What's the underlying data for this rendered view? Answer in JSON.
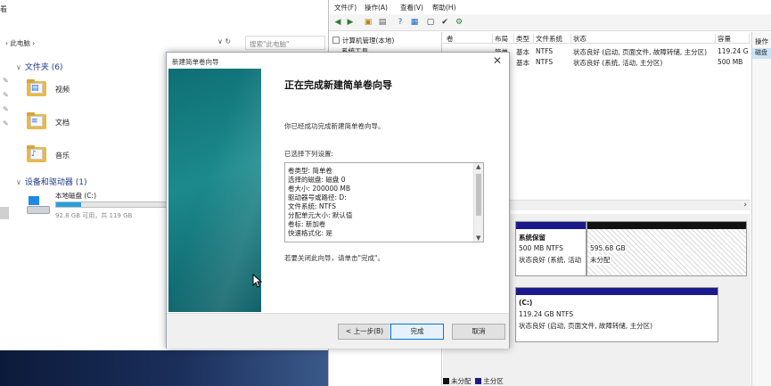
{
  "explorer": {
    "title_fragment": "看",
    "breadcrumb": "› 此电脑 ›",
    "address_controls": "∨ ↻",
    "search_placeholder": "搜索\"此电脑\"",
    "folders_header": "文件夹 (6)",
    "folders": [
      {
        "label": "视频",
        "icon": "video-folder-icon"
      },
      {
        "label": "文档",
        "icon": "document-folder-icon"
      },
      {
        "label": "音乐",
        "icon": "music-folder-icon"
      }
    ],
    "devices_header": "设备和驱动器 (1)",
    "drive": {
      "label": "本地磁盘 (C:)",
      "free_text": "92.8 GB 可用，共 119 GB",
      "used_fraction": 0.22
    }
  },
  "mmc": {
    "menu": [
      "文件(F)",
      "操作(A)",
      "查看(V)",
      "帮助(H)"
    ],
    "tree": [
      "计算机管理(本地)",
      "系统工具"
    ],
    "columns": [
      "卷",
      "布局",
      "类型",
      "文件系统",
      "状态",
      "容量"
    ],
    "rows": [
      {
        "vol": "",
        "layout": "简单",
        "type": "基本",
        "fs": "NTFS",
        "status": "状态良好 (启动, 页面文件, 故障转储, 主分区)",
        "size": "119.24 G"
      },
      {
        "vol": "",
        "layout": "简单",
        "type": "基本",
        "fs": "NTFS",
        "status": "状态良好 (系统, 活动, 主分区)",
        "size": "500 MB"
      }
    ],
    "actions_title": "操作",
    "actions_selected": "磁盘",
    "disk0": [
      {
        "name": "系统保留",
        "line1": "500 MB NTFS",
        "line2": "状态良好 (系统, 活动"
      },
      {
        "name": "",
        "line1": "595.68 GB",
        "line2": "未分配"
      }
    ],
    "disk1": {
      "name": "(C:)",
      "line1": "119.24 GB NTFS",
      "line2": "状态良好 (启动, 页面文件, 故障转储, 主分区)"
    },
    "legend": [
      {
        "label": "未分配",
        "color": "#111111"
      },
      {
        "label": "主分区",
        "color": "#1a1a8c"
      }
    ]
  },
  "wizard": {
    "window_title": "新建简单卷向导",
    "close_label": "✕",
    "heading": "正在完成新建简单卷向导",
    "intro": "你已经成功完成新建简单卷向导。",
    "settings_label": "已选择下列设置:",
    "settings": [
      "卷类型: 简单卷",
      "选择的磁盘: 磁盘 0",
      "卷大小: 200000 MB",
      "驱动器号或路径: D:",
      "文件系统: NTFS",
      "分配单元大小: 默认值",
      "卷标: 新加卷",
      "快速格式化: 是"
    ],
    "close_hint": "若要关闭此向导，请单击\"完成\"。",
    "back_button": "< 上一步(B)",
    "finish_button": "完成",
    "cancel_button": "取消"
  }
}
